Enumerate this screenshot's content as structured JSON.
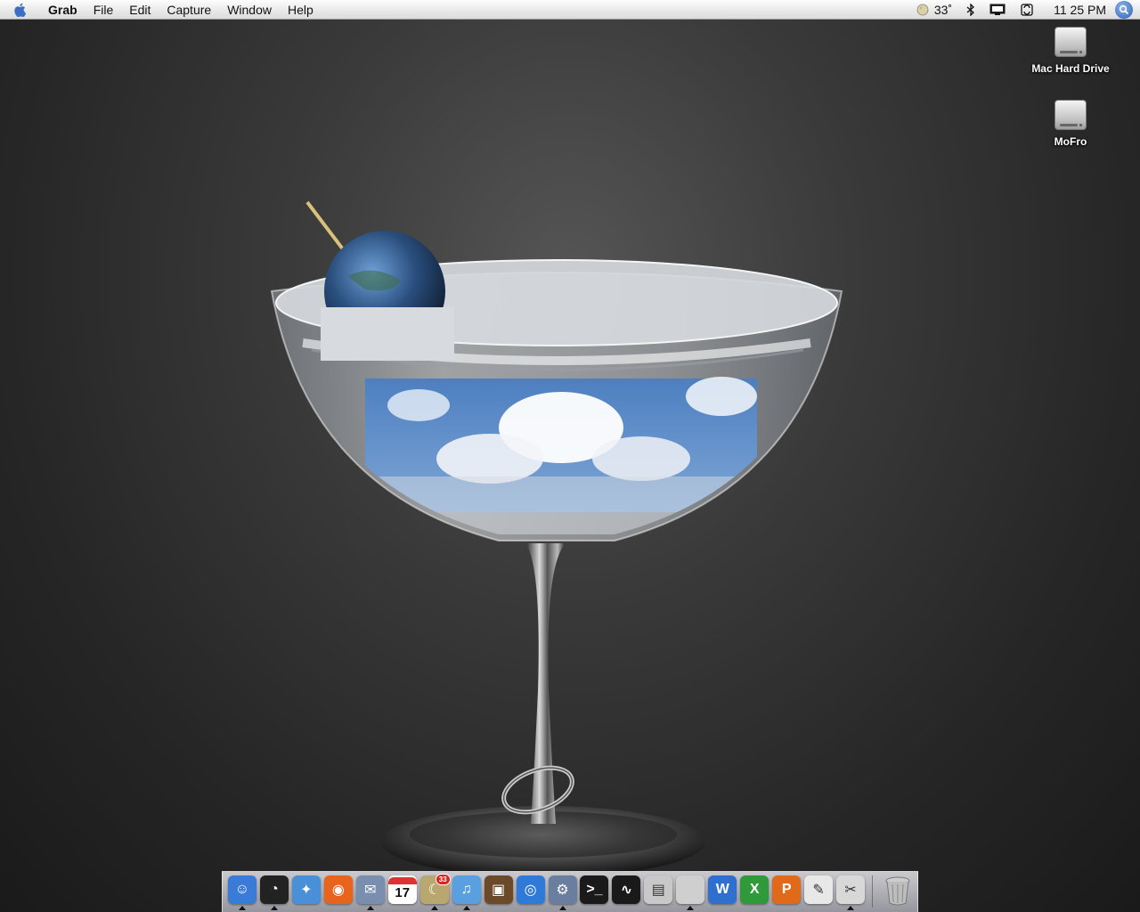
{
  "menubar": {
    "app_name": "Grab",
    "menus": [
      "File",
      "Edit",
      "Capture",
      "Window",
      "Help"
    ],
    "weather": "33˚",
    "clock": "11 25 PM",
    "icons": [
      "apple-icon",
      "moon-icon",
      "bluetooth-icon",
      "display-icon",
      "sync-icon",
      "spotlight-icon"
    ]
  },
  "desktop": {
    "icons": [
      {
        "label": "Mac Hard Drive",
        "icon": "hard-drive-icon"
      },
      {
        "label": "MoFro",
        "icon": "hard-drive-icon"
      }
    ]
  },
  "dock": {
    "apps": [
      {
        "icon": "finder-icon",
        "color": "#3b7bd8",
        "glyph": "☺",
        "running": true
      },
      {
        "icon": "dashboard-icon",
        "color": "#222222",
        "glyph": "◔",
        "running": true
      },
      {
        "icon": "safari-icon",
        "color": "#4a90d9",
        "glyph": "✦",
        "running": false
      },
      {
        "icon": "firefox-icon",
        "color": "#e8631c",
        "glyph": "◉",
        "running": false
      },
      {
        "icon": "mail-icon",
        "color": "#7a8fb0",
        "glyph": "✉",
        "running": true
      },
      {
        "icon": "ical-icon",
        "color": "#ffffff",
        "glyph": "17",
        "running": false
      },
      {
        "icon": "weather-moon-icon",
        "color": "#b8a870",
        "glyph": "☾",
        "running": true,
        "badge": "33"
      },
      {
        "icon": "itunes-icon",
        "color": "#5aa0e0",
        "glyph": "♫",
        "running": true
      },
      {
        "icon": "iphoto-icon",
        "color": "#6b4a2a",
        "glyph": "▣",
        "running": false
      },
      {
        "icon": "ichat-icon",
        "color": "#2f7ad8",
        "glyph": "◎",
        "running": false
      },
      {
        "icon": "sysprefs-icon",
        "color": "#6a7fa0",
        "glyph": "⚙",
        "running": true
      },
      {
        "icon": "terminal-icon",
        "color": "#1a1a1a",
        "glyph": ">_",
        "running": false
      },
      {
        "icon": "activity-monitor-icon",
        "color": "#1a1a1a",
        "glyph": "∿",
        "running": false
      },
      {
        "icon": "printer-icon",
        "color": "#c8c8c8",
        "glyph": "▤",
        "running": false
      },
      {
        "icon": "apple-store-icon",
        "color": "#cfcfcf",
        "glyph": "",
        "running": true
      },
      {
        "icon": "word-icon",
        "color": "#2f6fd0",
        "glyph": "W",
        "running": false
      },
      {
        "icon": "excel-icon",
        "color": "#2f9a3a",
        "glyph": "X",
        "running": false
      },
      {
        "icon": "powerpoint-icon",
        "color": "#e06a1a",
        "glyph": "P",
        "running": false
      },
      {
        "icon": "pen-tool-icon",
        "color": "#e8e8e8",
        "glyph": "✎",
        "running": false
      },
      {
        "icon": "grab-icon",
        "color": "#d8d8d8",
        "glyph": "✂",
        "running": true
      }
    ],
    "trash": {
      "icon": "trash-icon"
    }
  }
}
